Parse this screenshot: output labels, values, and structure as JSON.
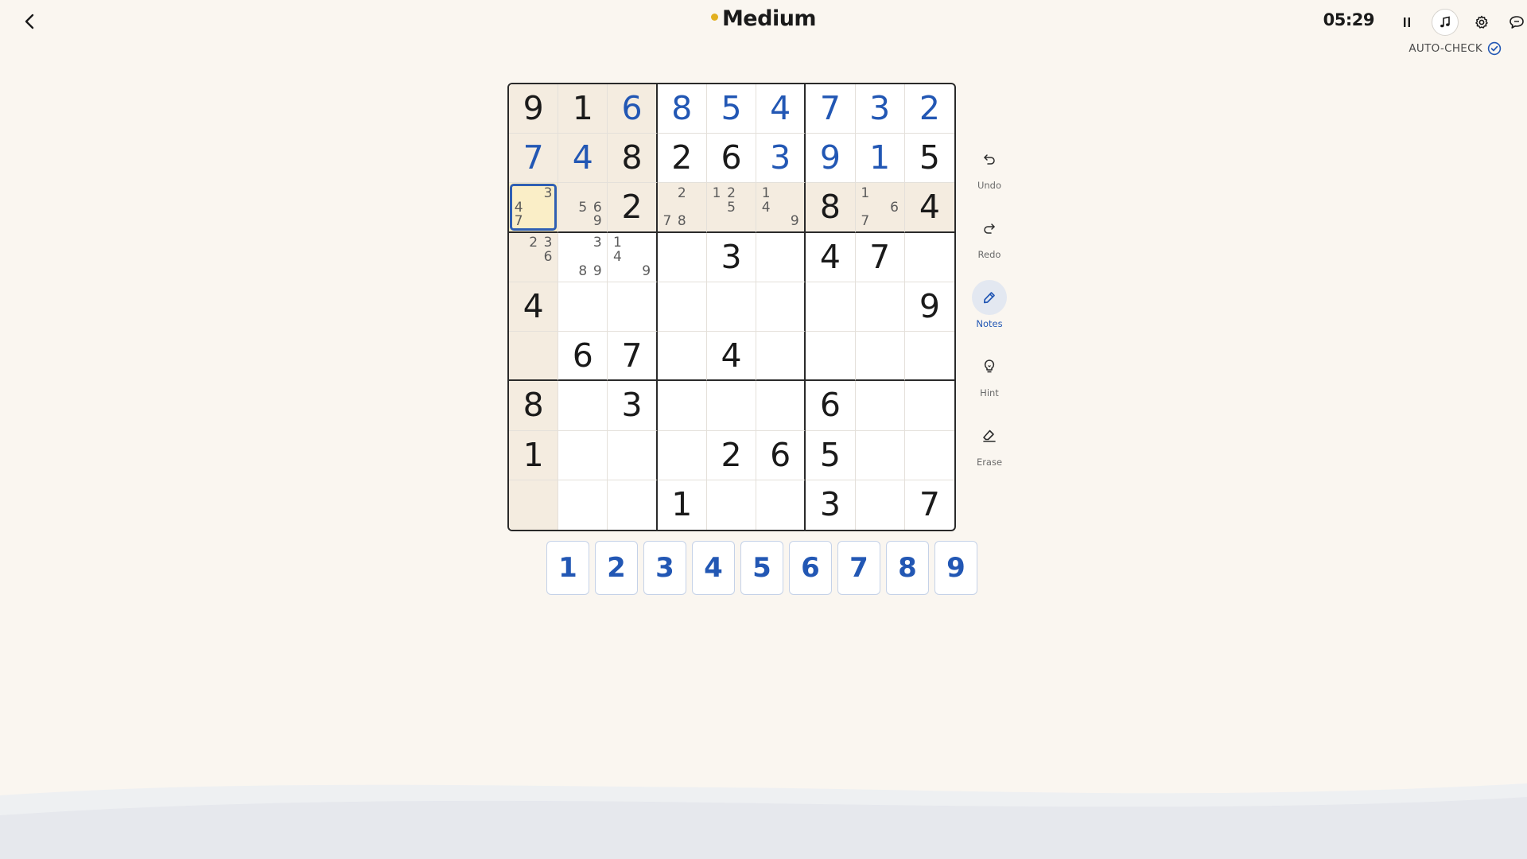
{
  "header": {
    "difficulty": "Medium",
    "difficulty_dot_color": "#e2b020",
    "timer": "05:29",
    "auto_check_label": "AUTO-CHECK",
    "icons": [
      "back-icon",
      "pause-icon",
      "music-note-icon",
      "gear-icon",
      "feedback-icon",
      "check-circle-icon"
    ]
  },
  "board": {
    "cells": [
      [
        {
          "v": "9",
          "t": "given"
        },
        {
          "v": "1",
          "t": "given"
        },
        {
          "v": "6",
          "t": "user"
        },
        {
          "v": "8",
          "t": "user"
        },
        {
          "v": "5",
          "t": "user"
        },
        {
          "v": "4",
          "t": "user"
        },
        {
          "v": "7",
          "t": "user"
        },
        {
          "v": "3",
          "t": "user"
        },
        {
          "v": "2",
          "t": "user"
        }
      ],
      [
        {
          "v": "7",
          "t": "user"
        },
        {
          "v": "4",
          "t": "user"
        },
        {
          "v": "8",
          "t": "given"
        },
        {
          "v": "2",
          "t": "given"
        },
        {
          "v": "6",
          "t": "given"
        },
        {
          "v": "3",
          "t": "user"
        },
        {
          "v": "9",
          "t": "user"
        },
        {
          "v": "1",
          "t": "user"
        },
        {
          "v": "5",
          "t": "given"
        }
      ],
      [
        {
          "notes": [
            "",
            "",
            "3",
            "4",
            "",
            "",
            "7",
            "",
            ""
          ],
          "sel": true
        },
        {
          "notes": [
            "",
            "",
            "",
            "",
            "5",
            "6",
            "",
            "",
            "9"
          ]
        },
        {
          "v": "2",
          "t": "given"
        },
        {
          "notes": [
            "",
            "2",
            "",
            "",
            "",
            "",
            "7",
            "8",
            ""
          ]
        },
        {
          "notes": [
            "1",
            "2",
            "",
            "",
            "5",
            "",
            "",
            "",
            ""
          ]
        },
        {
          "notes": [
            "1",
            "",
            "",
            "4",
            "",
            "",
            "",
            "",
            "9"
          ]
        },
        {
          "v": "8",
          "t": "given"
        },
        {
          "notes": [
            "1",
            "",
            "",
            "",
            "",
            "6",
            "7",
            "",
            ""
          ]
        },
        {
          "v": "4",
          "t": "given"
        }
      ],
      [
        {
          "notes": [
            "",
            "2",
            "3",
            "",
            "",
            "6",
            "",
            "",
            ""
          ]
        },
        {
          "notes": [
            "",
            "",
            "3",
            "",
            "",
            "",
            "",
            "8",
            "9"
          ]
        },
        {
          "notes": [
            "1",
            "",
            "",
            "4",
            "",
            "",
            "",
            "",
            "9"
          ]
        },
        {},
        {
          "v": "3",
          "t": "given"
        },
        {},
        {
          "v": "4",
          "t": "given"
        },
        {
          "v": "7",
          "t": "given"
        },
        {}
      ],
      [
        {
          "v": "4",
          "t": "given"
        },
        {},
        {},
        {},
        {},
        {},
        {},
        {},
        {
          "v": "9",
          "t": "given"
        }
      ],
      [
        {},
        {
          "v": "6",
          "t": "given"
        },
        {
          "v": "7",
          "t": "given"
        },
        {},
        {
          "v": "4",
          "t": "given"
        },
        {},
        {},
        {},
        {}
      ],
      [
        {
          "v": "8",
          "t": "given"
        },
        {},
        {
          "v": "3",
          "t": "given"
        },
        {},
        {},
        {},
        {
          "v": "6",
          "t": "given"
        },
        {},
        {}
      ],
      [
        {
          "v": "1",
          "t": "given"
        },
        {},
        {},
        {},
        {
          "v": "2",
          "t": "given"
        },
        {
          "v": "6",
          "t": "given"
        },
        {
          "v": "5",
          "t": "given"
        },
        {},
        {}
      ],
      [
        {},
        {},
        {},
        {
          "v": "1",
          "t": "given"
        },
        {},
        {},
        {
          "v": "3",
          "t": "given"
        },
        {},
        {
          "v": "7",
          "t": "given"
        }
      ]
    ],
    "selected": {
      "row": 2,
      "col": 0
    }
  },
  "tools": {
    "undo": "Undo",
    "redo": "Redo",
    "notes": "Notes",
    "hint": "Hint",
    "erase": "Erase",
    "active": "notes"
  },
  "numpad": [
    "1",
    "2",
    "3",
    "4",
    "5",
    "6",
    "7",
    "8",
    "9"
  ],
  "colors": {
    "background": "#faf6f0",
    "user_digit": "#2257b4",
    "given_digit": "#1a1a1a",
    "highlight": "#f4ece0",
    "selected": "#faeec7",
    "selected_border": "#2f5fb3"
  }
}
